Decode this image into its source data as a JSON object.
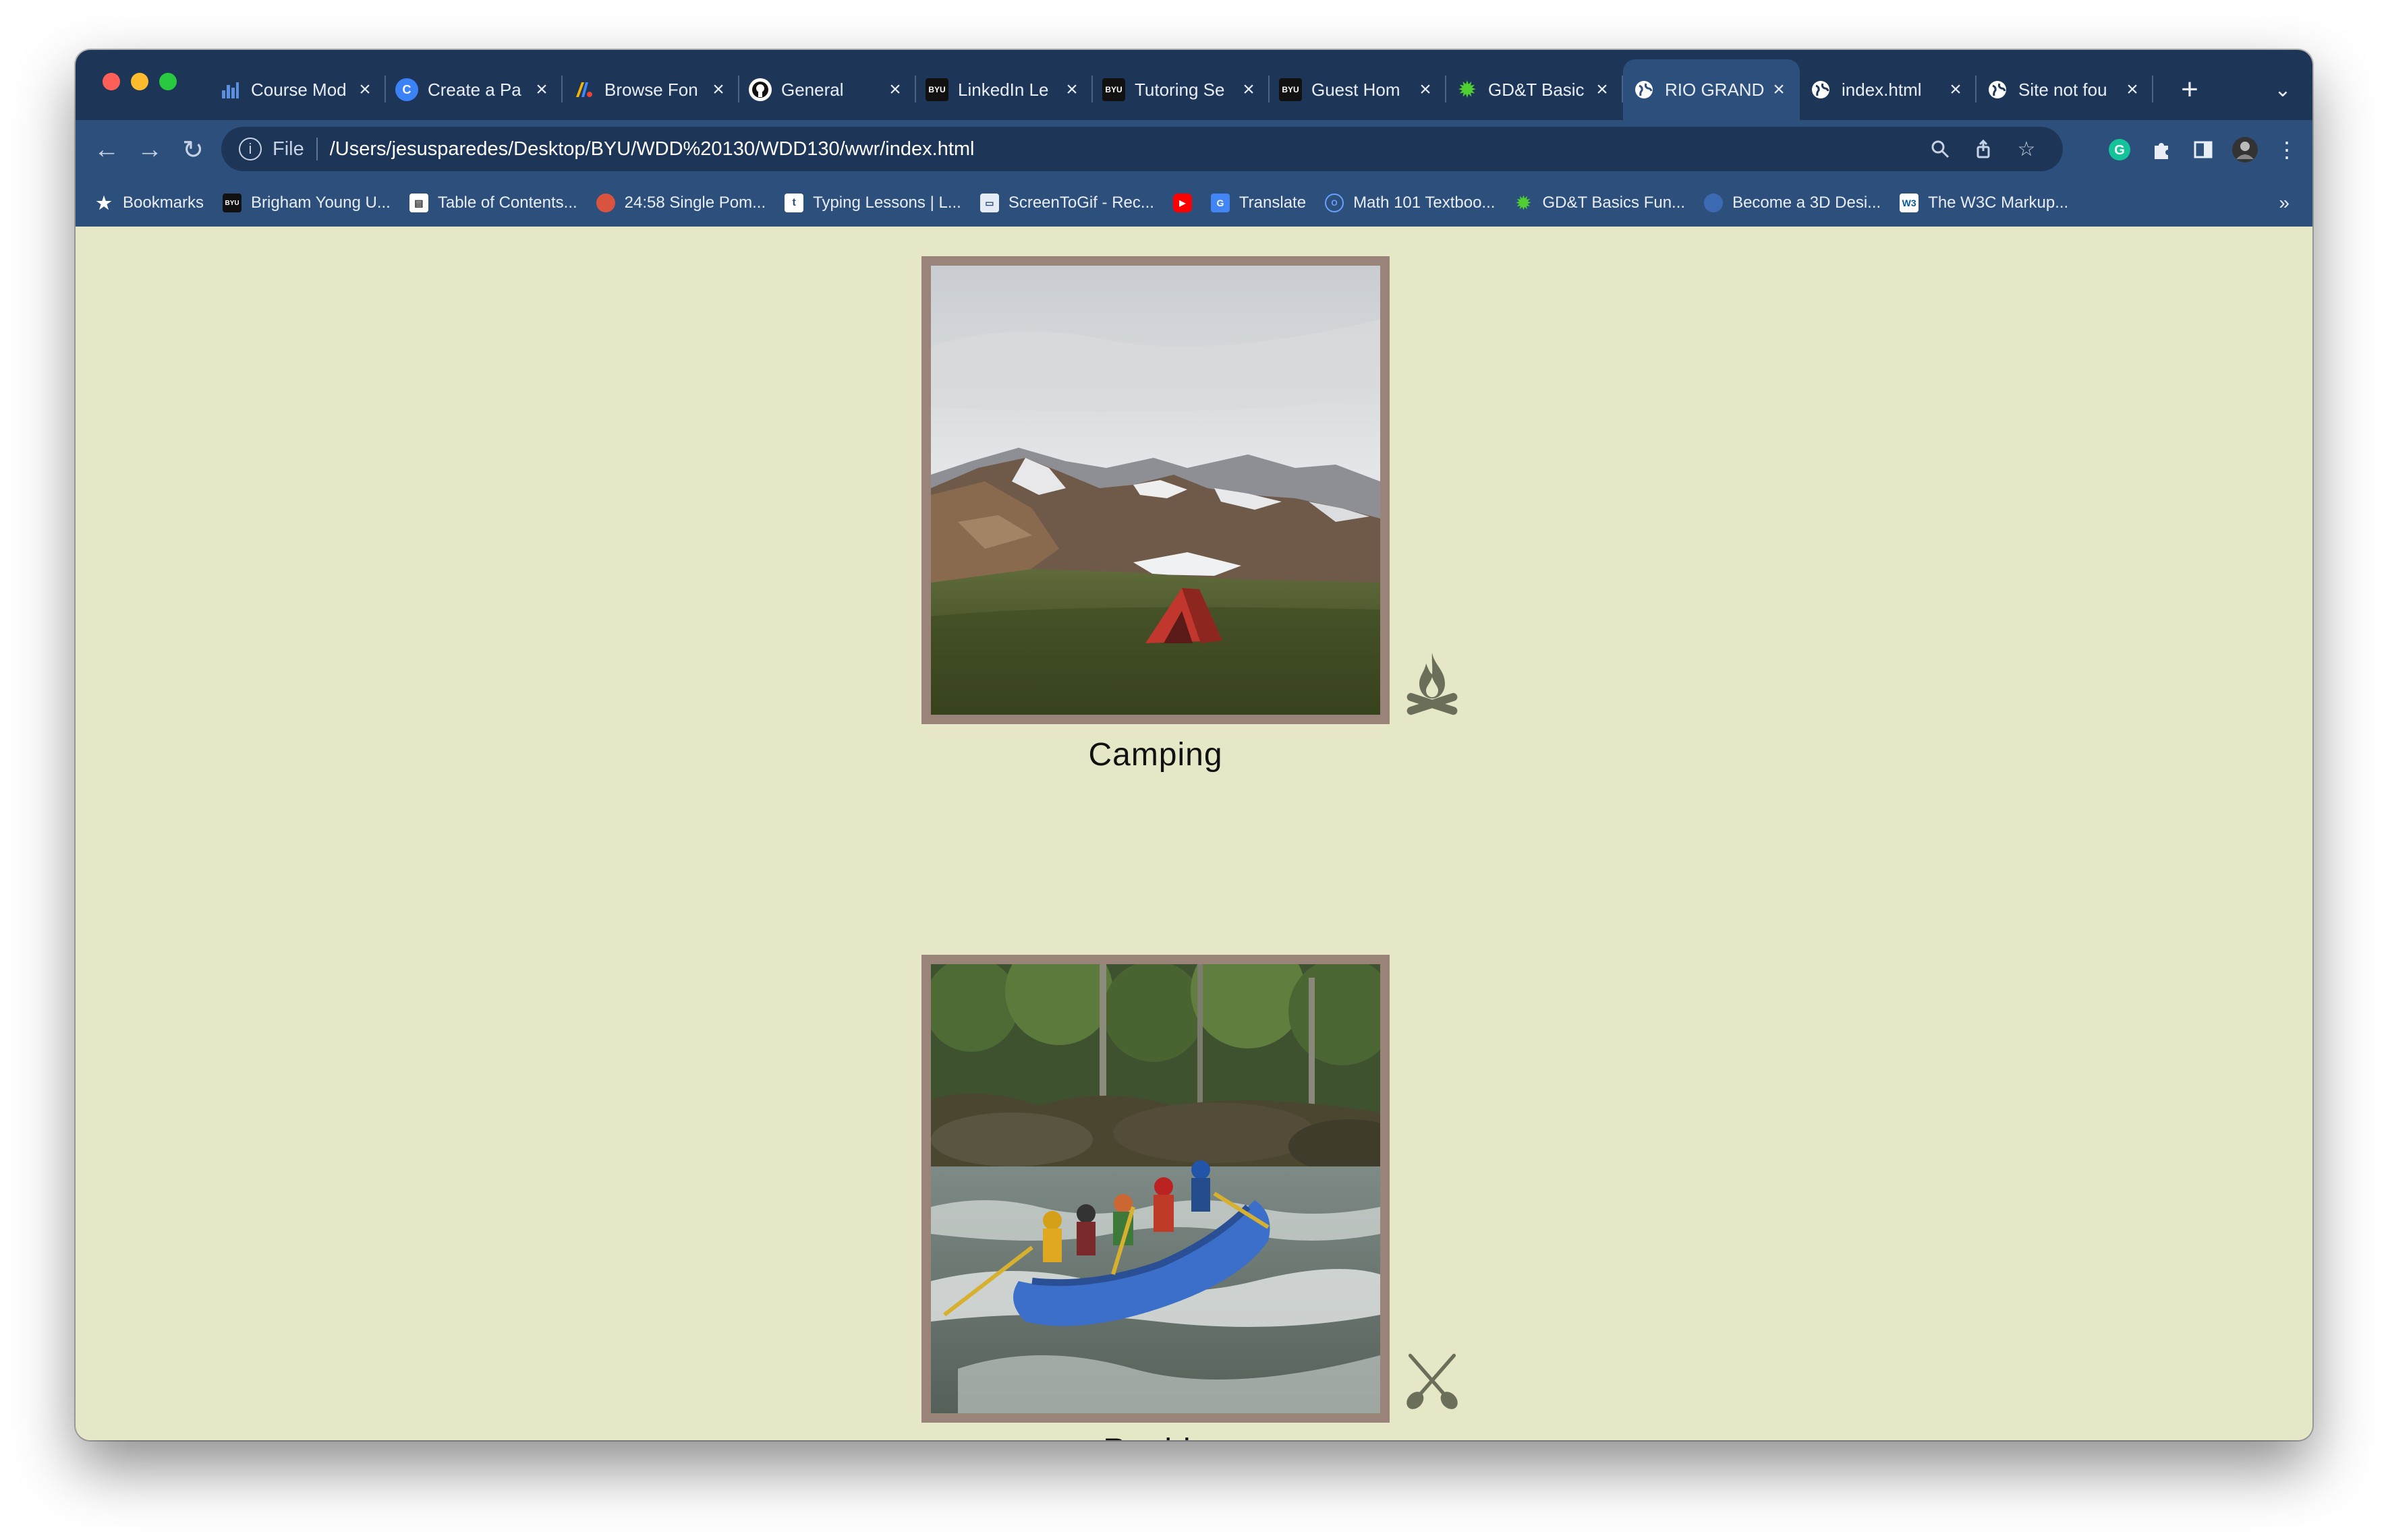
{
  "browser": {
    "tabs": [
      {
        "label": "Course Mod",
        "icon": "bar-chart-icon",
        "color": "#4a7fd6"
      },
      {
        "label": "Create a Pa",
        "icon": "circle-c-icon",
        "color": "#3b82f6"
      },
      {
        "label": "Browse Fon",
        "icon": "google-fonts-icon",
        "color": "#e0483c"
      },
      {
        "label": "General",
        "icon": "github-icon",
        "color": "#ffffff"
      },
      {
        "label": "LinkedIn Le",
        "icon": "byu-icon",
        "color": "#111111"
      },
      {
        "label": "Tutoring Se",
        "icon": "byu-icon",
        "color": "#111111"
      },
      {
        "label": "Guest Hom",
        "icon": "byu-icon",
        "color": "#111111"
      },
      {
        "label": "GD&T Basic",
        "icon": "gear-icon",
        "color": "#3fae2a"
      },
      {
        "label": "RIO GRAND",
        "icon": "globe-icon",
        "color": "#ffffff",
        "active": true
      },
      {
        "label": "index.html",
        "icon": "globe-icon",
        "color": "#ffffff"
      },
      {
        "label": "Site not fou",
        "icon": "globe-icon",
        "color": "#ffffff"
      }
    ],
    "address": {
      "scheme": "File",
      "url": "/Users/jesusparedes/Desktop/BYU/WDD%20130/WDD130/wwr/index.html"
    },
    "bookmarks": [
      {
        "label": "Bookmarks",
        "icon": "star-icon"
      },
      {
        "label": "Brigham Young U...",
        "icon": "byu-icon"
      },
      {
        "label": "Table of Contents...",
        "icon": "book-icon"
      },
      {
        "label": "24:58 Single Pom...",
        "icon": "tomato-icon"
      },
      {
        "label": "Typing Lessons | L...",
        "icon": "typing-icon"
      },
      {
        "label": "ScreenToGif - Rec...",
        "icon": "screen-icon"
      },
      {
        "label": "",
        "icon": "youtube-icon"
      },
      {
        "label": "Translate",
        "icon": "translate-icon"
      },
      {
        "label": "Math 101 Textboo...",
        "icon": "math-icon"
      },
      {
        "label": "GD&T Basics Fun...",
        "icon": "gear-icon"
      },
      {
        "label": "Become a 3D Desi...",
        "icon": "globe-icon"
      },
      {
        "label": "The W3C Markup...",
        "icon": "w3c-icon"
      }
    ],
    "bookmarks_more": "»"
  },
  "page": {
    "cards": [
      {
        "caption": "Camping",
        "image": "mountain-tent-photo",
        "icon": "campfire-icon"
      },
      {
        "caption": "Rapids",
        "image": "river-rafting-photo",
        "icon": "paddles-icon"
      }
    ]
  }
}
